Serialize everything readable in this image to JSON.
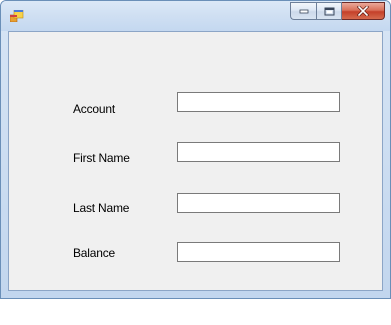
{
  "window": {
    "title": "",
    "icon": "form-icon",
    "caption_buttons": [
      "minimize",
      "maximize",
      "close"
    ]
  },
  "form": {
    "fields": [
      {
        "label": "Account",
        "value": ""
      },
      {
        "label": "First Name",
        "value": ""
      },
      {
        "label": "Last Name",
        "value": ""
      },
      {
        "label": "Balance",
        "value": ""
      }
    ]
  },
  "colors": {
    "client_background": "#f0f0f0",
    "close_button": "#c4402a",
    "frame": "#c2d6ee"
  }
}
